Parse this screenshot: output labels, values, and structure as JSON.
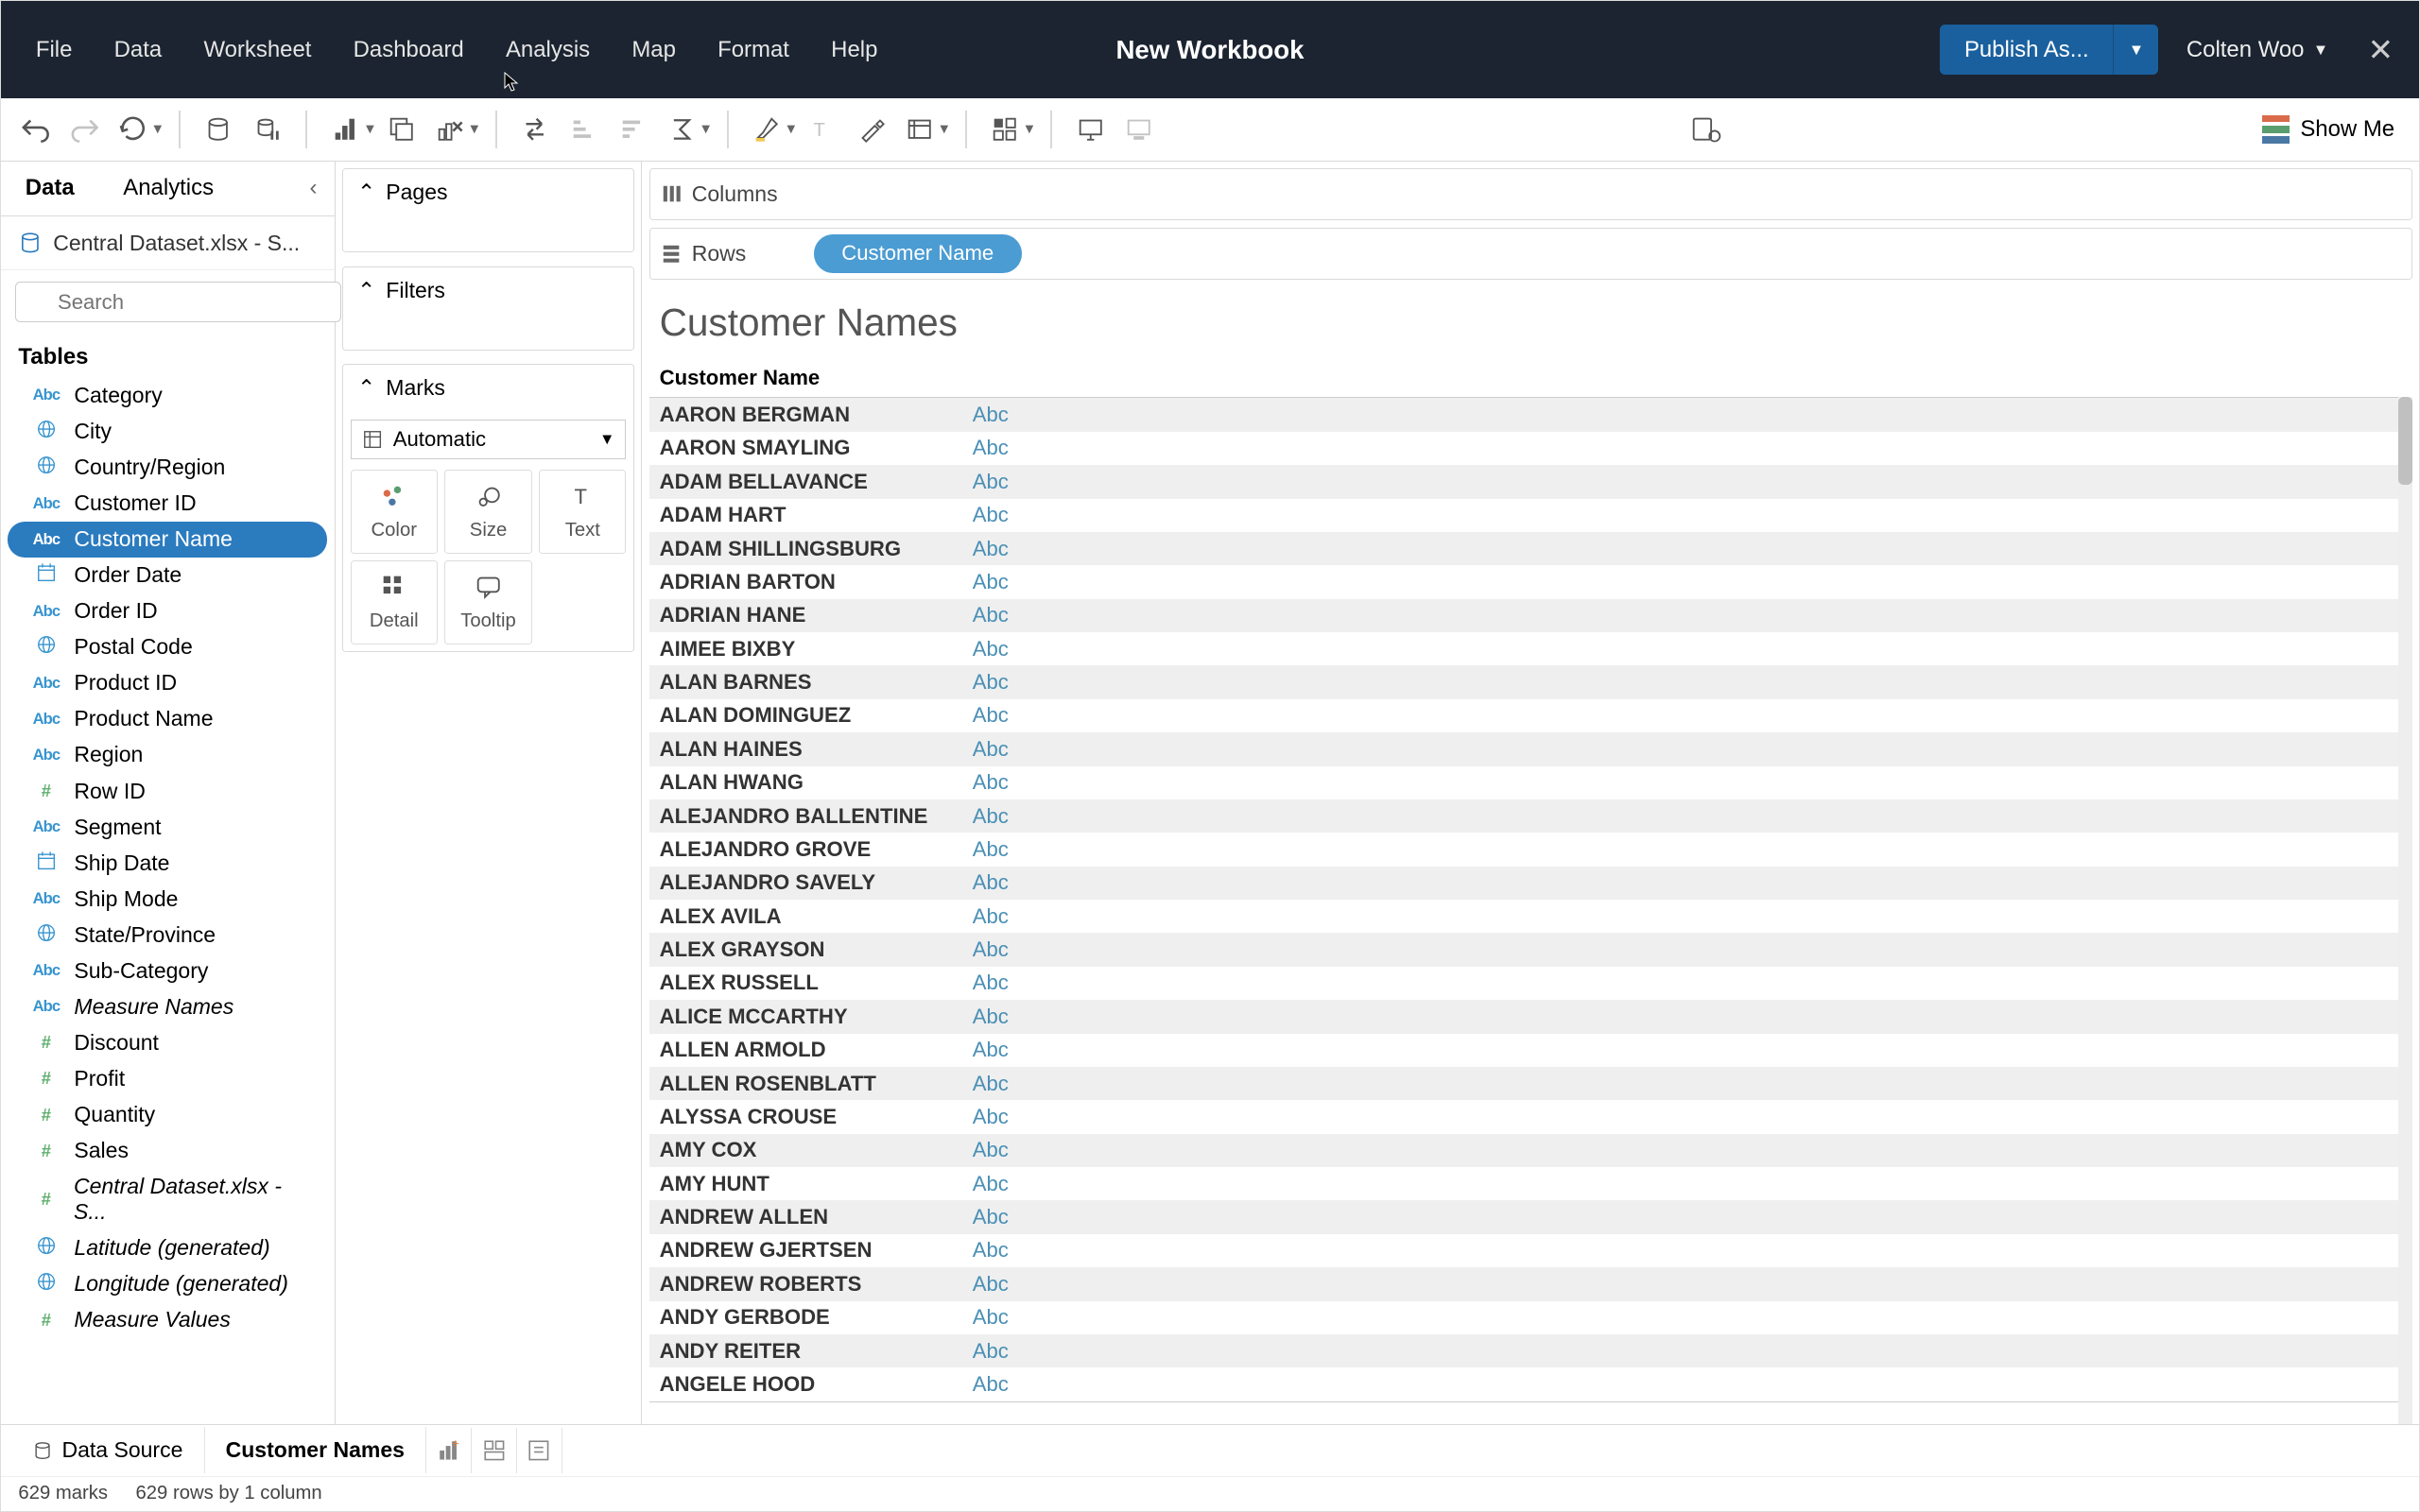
{
  "titlebar": {
    "menus": [
      "File",
      "Data",
      "Worksheet",
      "Dashboard",
      "Analysis",
      "Map",
      "Format",
      "Help"
    ],
    "title": "New Workbook",
    "publish_label": "Publish As...",
    "user_label": "Colten Woo"
  },
  "toolbar": {
    "showme_label": "Show Me",
    "icons": [
      "undo-icon",
      "redo-icon",
      "replay-icon",
      "replay-caret",
      "sep",
      "new-datasource-icon",
      "pause-auto-updates-icon",
      "sep",
      "new-worksheet-icon",
      "duplicate-icon",
      "clear-icon",
      "sep",
      "swap-icon",
      "sort-asc-icon",
      "sort-desc-icon",
      "totals-icon",
      "sep",
      "highlight-icon",
      "labels-icon",
      "format-icon",
      "fit-icon",
      "sep",
      "fix-axes-icon",
      "sep",
      "presentation-icon",
      "device-preview-icon"
    ]
  },
  "sidebar": {
    "tabs": {
      "data": "Data",
      "analytics": "Analytics"
    },
    "datasource": "Central Dataset.xlsx - S...",
    "search_placeholder": "Search",
    "tables_header": "Tables",
    "fields": [
      {
        "name": "Category",
        "type": "abc"
      },
      {
        "name": "City",
        "type": "globe"
      },
      {
        "name": "Country/Region",
        "type": "globe"
      },
      {
        "name": "Customer ID",
        "type": "abc"
      },
      {
        "name": "Customer Name",
        "type": "abc",
        "selected": true
      },
      {
        "name": "Order Date",
        "type": "cal"
      },
      {
        "name": "Order ID",
        "type": "abc"
      },
      {
        "name": "Postal Code",
        "type": "globe"
      },
      {
        "name": "Product ID",
        "type": "abc"
      },
      {
        "name": "Product Name",
        "type": "abc"
      },
      {
        "name": "Region",
        "type": "abc"
      },
      {
        "name": "Row ID",
        "type": "hash"
      },
      {
        "name": "Segment",
        "type": "abc"
      },
      {
        "name": "Ship Date",
        "type": "cal"
      },
      {
        "name": "Ship Mode",
        "type": "abc"
      },
      {
        "name": "State/Province",
        "type": "globe"
      },
      {
        "name": "Sub-Category",
        "type": "abc"
      },
      {
        "name": "Measure Names",
        "type": "abc",
        "italic": true
      },
      {
        "name": "Discount",
        "type": "hash"
      },
      {
        "name": "Profit",
        "type": "hash"
      },
      {
        "name": "Quantity",
        "type": "hash"
      },
      {
        "name": "Sales",
        "type": "hash"
      },
      {
        "name": "Central Dataset.xlsx - S...",
        "type": "hash",
        "italic": true
      },
      {
        "name": "Latitude (generated)",
        "type": "globe",
        "italic": true
      },
      {
        "name": "Longitude (generated)",
        "type": "globe",
        "italic": true
      },
      {
        "name": "Measure Values",
        "type": "hash",
        "italic": true
      }
    ]
  },
  "shelves": {
    "pages": "Pages",
    "filters": "Filters",
    "marks": "Marks",
    "marks_select": "Automatic",
    "cards": [
      "Color",
      "Size",
      "Text",
      "Detail",
      "Tooltip"
    ]
  },
  "shelf_rows": {
    "columns": {
      "label": "Columns",
      "pills": []
    },
    "rows": {
      "label": "Rows",
      "pills": [
        "Customer Name"
      ]
    }
  },
  "viz": {
    "title": "Customer Names",
    "column_header": "Customer Name",
    "mark_label": "Abc",
    "rows": [
      "AARON BERGMAN",
      "AARON SMAYLING",
      "ADAM BELLAVANCE",
      "ADAM HART",
      "ADAM SHILLINGSBURG",
      "ADRIAN BARTON",
      "ADRIAN HANE",
      "AIMEE BIXBY",
      "ALAN BARNES",
      "ALAN DOMINGUEZ",
      "ALAN HAINES",
      "ALAN HWANG",
      "ALEJANDRO BALLENTINE",
      "ALEJANDRO GROVE",
      "ALEJANDRO SAVELY",
      "ALEX AVILA",
      "ALEX GRAYSON",
      "ALEX RUSSELL",
      "ALICE MCCARTHY",
      "ALLEN ARMOLD",
      "ALLEN ROSENBLATT",
      "ALYSSA CROUSE",
      "AMY COX",
      "AMY HUNT",
      "ANDREW ALLEN",
      "ANDREW GJERTSEN",
      "ANDREW ROBERTS",
      "ANDY GERBODE",
      "ANDY REITER",
      "ANGELE HOOD"
    ]
  },
  "bottom": {
    "datasource": "Data Source",
    "sheet": "Customer Names"
  },
  "status": {
    "marks": "629 marks",
    "dims": "629 rows by 1 column"
  }
}
